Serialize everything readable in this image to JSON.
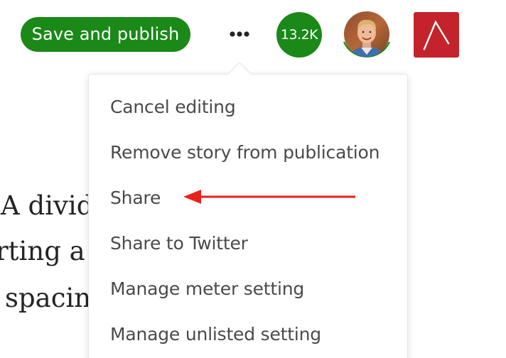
{
  "toolbar": {
    "save_label": "Save and publish",
    "more_icon": "ellipsis-horizontal-icon",
    "count_badge": "13.2K",
    "avatar_icon": "user-avatar-photo",
    "publication_icon": "publication-logo-icon"
  },
  "menu": {
    "items": [
      {
        "label": "Cancel editing"
      },
      {
        "label": "Remove story from publication"
      },
      {
        "label": "Share"
      },
      {
        "label": "Share to Twitter"
      },
      {
        "label": "Manage meter setting"
      },
      {
        "label": "Manage unlisted setting"
      }
    ]
  },
  "article": {
    "lines": [
      "A divid",
      "rting a n",
      "spacing"
    ]
  },
  "annotation": {
    "arrow_color": "#e8221b",
    "arrow_target": "Share"
  },
  "colors": {
    "accent_green": "#1a8917",
    "publication_red": "#c4232b",
    "menu_text": "#4a4a4a"
  }
}
